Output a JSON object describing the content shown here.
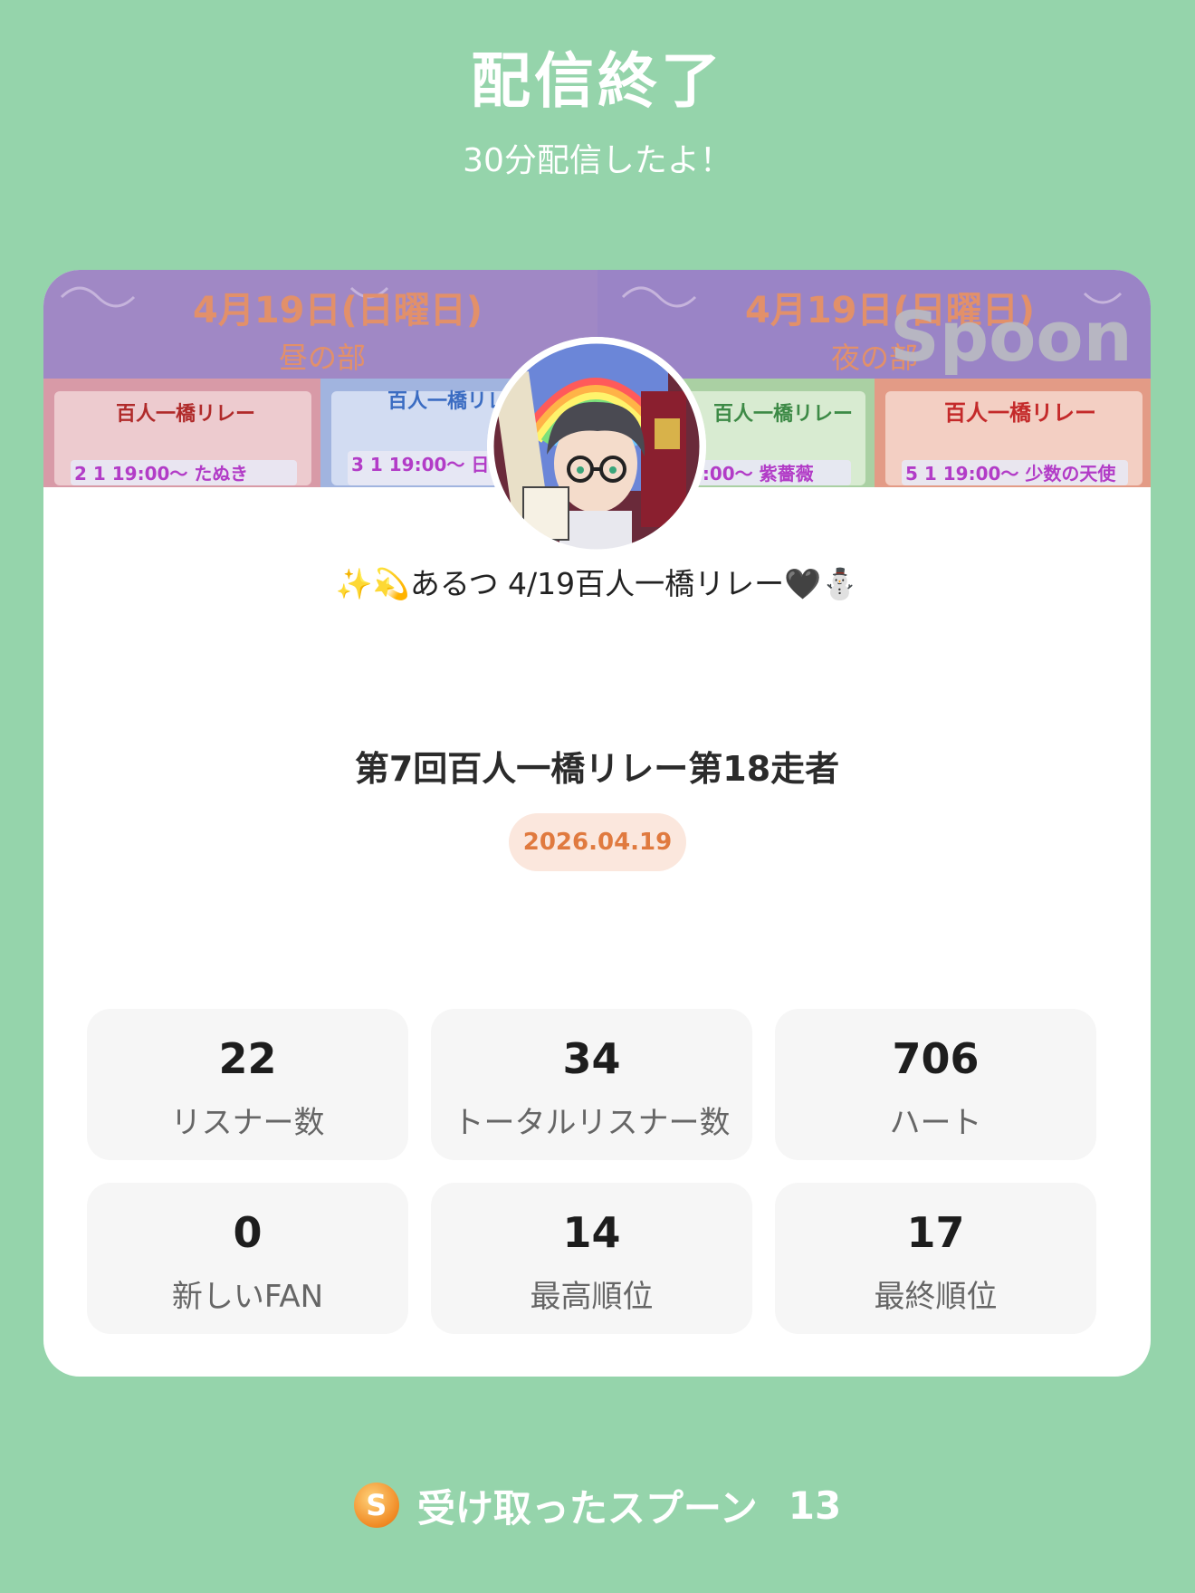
{
  "header": {
    "title": "配信終了",
    "subtitle": "30分配信したよ！"
  },
  "banner": {
    "date_left": "4月19日(日曜日)",
    "session_left": "昼の部",
    "date_right": "4月19日(日曜日)",
    "session_right": "夜の部",
    "brand": "Spoon",
    "relay_label": "百人一橋リレー",
    "slots": [
      "2 1 19:00〜 たぬき",
      "3 1 19:00〜 日向",
      "19:00〜 紫薔薇",
      "5 1 19:00〜 少数の天使"
    ],
    "colors": {
      "top_left": "#9f86c4",
      "top_right": "#9b83c6",
      "panel_1": "#d99aa6",
      "panel_2": "#9fb3e0",
      "panel_3": "#a9cfa3",
      "panel_4": "#e69b85"
    }
  },
  "profile": {
    "live_title": "✨💫あるつ 4/19百人一橋リレー🖤⛄"
  },
  "event": {
    "title": "第7回百人一橋リレー第18走者",
    "date": "2026.04.19"
  },
  "stats": [
    {
      "value": "22",
      "label": "リスナー数"
    },
    {
      "value": "34",
      "label": "トータルリスナー数"
    },
    {
      "value": "706",
      "label": "ハート"
    },
    {
      "value": "0",
      "label": "新しいFAN"
    },
    {
      "value": "14",
      "label": "最高順位"
    },
    {
      "value": "17",
      "label": "最終順位"
    }
  ],
  "footer": {
    "spoon_icon_letter": "S",
    "spoon_label": "受け取ったスプーン",
    "spoon_count": "13"
  },
  "theme": {
    "background": "#95d4ab",
    "date_badge_bg": "#fbe7dd",
    "date_badge_text": "#e07a3f"
  }
}
